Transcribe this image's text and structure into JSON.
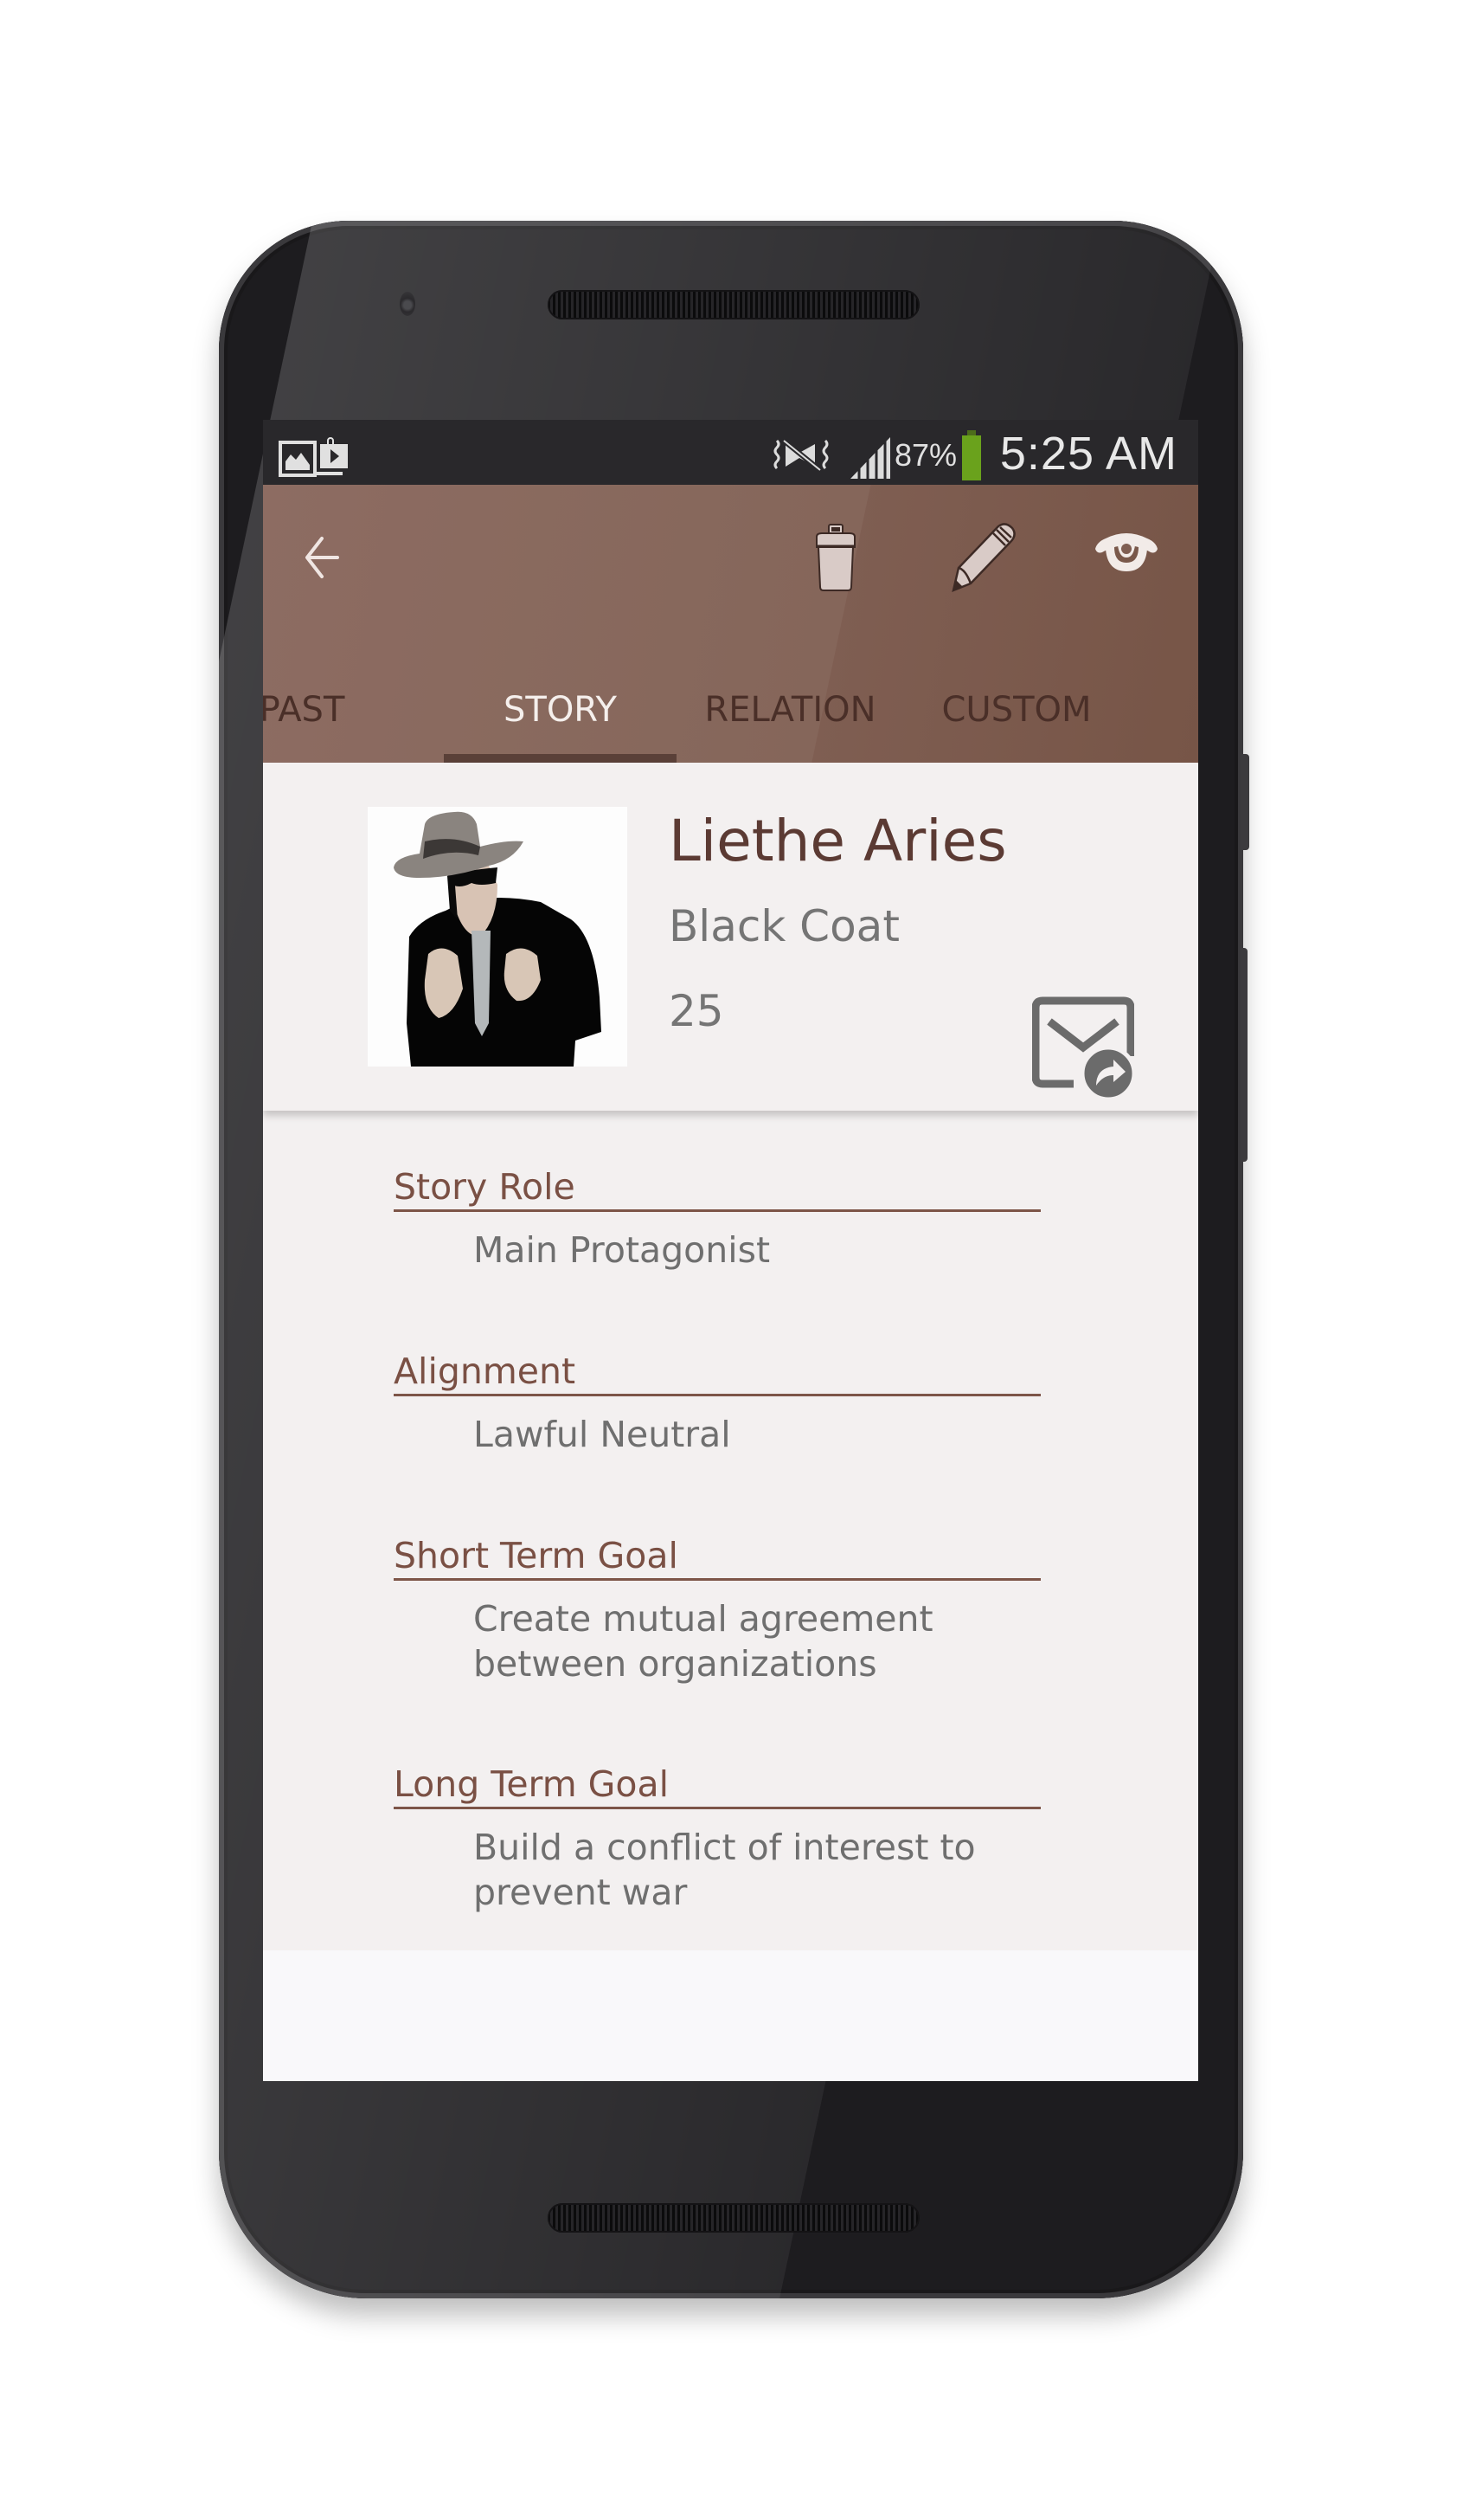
{
  "status_bar": {
    "left_icons": [
      "gallery-icon",
      "play-store-icon"
    ],
    "right_icons": [
      "vibrate-mute-icon",
      "signal-icon",
      "battery-icon"
    ],
    "battery_percent": "87%",
    "battery_level": 0.87,
    "battery_color": "#6aa21c",
    "time": "5:25 AM"
  },
  "app_bar": {
    "back_icon": "arrow-left-icon",
    "actions": [
      {
        "name": "delete",
        "icon": "trash-icon"
      },
      {
        "name": "edit",
        "icon": "pencil-icon"
      },
      {
        "name": "view",
        "icon": "eye-icon"
      }
    ],
    "color": "#7f5e52"
  },
  "tabs": [
    {
      "label": "PAST",
      "active": false
    },
    {
      "label": "STORY",
      "active": true
    },
    {
      "label": "RELATION",
      "active": false
    },
    {
      "label": "CUSTOM",
      "active": false
    }
  ],
  "profile": {
    "name": "Liethe Aries",
    "alias": "Black Coat",
    "age": "25",
    "avatar": "character-portrait-man-in-fedora-and-black-coat",
    "share_icon": "email-forward-icon"
  },
  "fields": [
    {
      "label": "Story Role",
      "value": "Main Protagonist"
    },
    {
      "label": "Alignment",
      "value": "Lawful Neutral"
    },
    {
      "label": "Short Term Goal",
      "value": "Create mutual agreement between organizations"
    },
    {
      "label": "Long Term Goal",
      "value": "Build a conflict of interest to prevent war"
    }
  ]
}
